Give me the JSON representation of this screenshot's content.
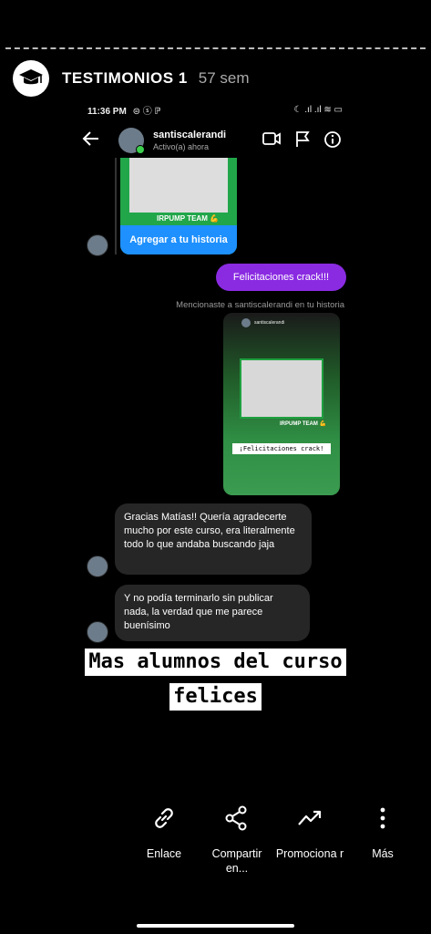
{
  "story": {
    "title": "TESTIMONIOS 1",
    "time": "57 sem"
  },
  "phone_status": {
    "time": "11:36 PM",
    "icons_left": "⊜ ⓢ ℙ",
    "icons_right": "☾ .ıl .ıl ≋ ▭"
  },
  "chat": {
    "username": "santiscalerandi",
    "status": "Activo(a) ahora",
    "add_to_story": "Agregar a tu historia",
    "team_label": "IRPUMP TEAM 💪",
    "sent_message": "Felicitaciones crack!!!",
    "mention_note": "Mencionaste a santiscalerandi en tu historia",
    "shared_story": {
      "user": "santiscalerandi",
      "team_label": "IRPUMP TEAM 💪",
      "sticker": "¡Felicitaciones crack!"
    },
    "received": [
      "Gracias Matías!! Quería agradecerte mucho por este curso, era literalmente todo lo que andaba buscando jaja",
      "Y no podía terminarlo sin publicar nada, la verdad que me parece buenísimo"
    ]
  },
  "caption": {
    "line1": "Mas alumnos del curso",
    "line2": "felices"
  },
  "actions": [
    {
      "icon": "link-icon",
      "label": "Enlace"
    },
    {
      "icon": "share-icon",
      "label": "Compartir en..."
    },
    {
      "icon": "trending-up-icon",
      "label": "Promociona r"
    },
    {
      "icon": "more-vertical-icon",
      "label": "Más"
    }
  ]
}
